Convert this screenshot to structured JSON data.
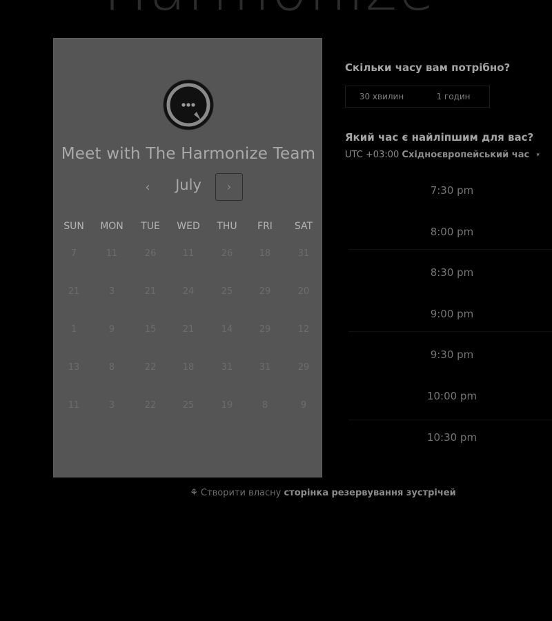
{
  "brand_wordmark": "Harmonize",
  "card": {
    "title": "Meet with The Harmonize Team",
    "logo_icon": "chat-bubble-ellipsis-icon",
    "month": "July",
    "prev_label": "‹",
    "next_label": "›",
    "weekdays": [
      "SUN",
      "MON",
      "TUE",
      "WED",
      "THU",
      "FRI",
      "SAT"
    ],
    "weeks": [
      [
        "7",
        "11",
        "26",
        "11",
        "26",
        "18",
        "31"
      ],
      [
        "21",
        "3",
        "21",
        "24",
        "25",
        "29",
        "20"
      ],
      [
        "1",
        "9",
        "15",
        "21",
        "14",
        "29",
        "12"
      ],
      [
        "13",
        "8",
        "22",
        "18",
        "31",
        "31",
        "29"
      ],
      [
        "11",
        "3",
        "22",
        "25",
        "19",
        "8",
        "9"
      ]
    ]
  },
  "duration": {
    "question": "Скільки часу вам потрібно?",
    "options": [
      "30 хвилин",
      "1 годин"
    ]
  },
  "time": {
    "question": "Який час є найліпшим для вас?",
    "tz_offset": "UTC +03:00",
    "tz_name": "Східноєвропейський час",
    "tz_caret": "▾",
    "slots": [
      "7:30 pm",
      "8:00 pm",
      "8:30 pm",
      "9:00 pm",
      "9:30 pm",
      "10:00 pm",
      "10:30 pm"
    ]
  },
  "footer": {
    "icon": "sprocket-icon",
    "icon_glyph": "⚘",
    "prefix": "Створити власну",
    "link": "сторінка резервування зустрічей"
  },
  "colors": {
    "background": "#000000",
    "card": "#555555"
  }
}
